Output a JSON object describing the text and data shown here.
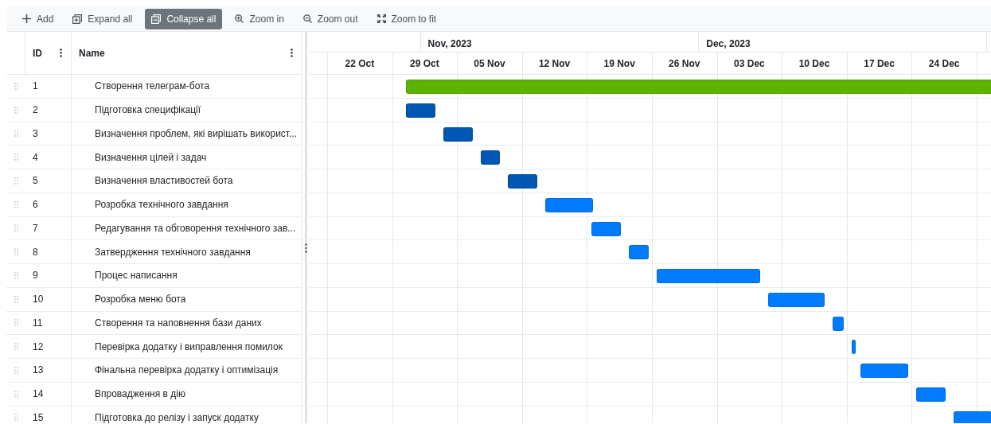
{
  "toolbar": [
    {
      "label": "Add",
      "kind": "add",
      "selected": false
    },
    {
      "label": "Expand all",
      "kind": "expand",
      "selected": false
    },
    {
      "label": "Collapse all",
      "kind": "collapse",
      "selected": true
    },
    {
      "label": "Zoom in",
      "kind": "zoomin",
      "selected": false
    },
    {
      "label": "Zoom out",
      "kind": "zoomout",
      "selected": false
    },
    {
      "label": "Zoom to fit",
      "kind": "fit",
      "selected": false
    }
  ],
  "grid": {
    "columns": [
      "ID",
      "Name"
    ]
  },
  "timeline": {
    "months": [
      "Nov, 2023",
      "Dec, 2023"
    ],
    "weeks": [
      "22 Oct",
      "29 Oct",
      "05 Nov",
      "12 Nov",
      "19 Nov",
      "26 Nov",
      "03 Dec",
      "10 Dec",
      "17 Dec",
      "24 Dec"
    ]
  },
  "tasks": [
    {
      "id": "1",
      "name": "Створення телеграм-бота",
      "color": "#5cb300"
    },
    {
      "id": "2",
      "name": "Підготовка специфікації",
      "color": "#0056b3"
    },
    {
      "id": "3",
      "name": "Визначення проблем, які вирішать використ...",
      "color": "#0056b3"
    },
    {
      "id": "4",
      "name": "Визначення цілей і задач",
      "color": "#0056b3"
    },
    {
      "id": "5",
      "name": "Визначення властивостей бота",
      "color": "#0056b3"
    },
    {
      "id": "6",
      "name": "Розробка технічного завдання",
      "color": "#007bff"
    },
    {
      "id": "7",
      "name": "Редагування та обговорення технічного зав...",
      "color": "#007bff"
    },
    {
      "id": "8",
      "name": "Затвердження технічного завдання",
      "color": "#007bff"
    },
    {
      "id": "9",
      "name": "Процес написання",
      "color": "#007bff"
    },
    {
      "id": "10",
      "name": "Розробка меню бота",
      "color": "#007bff"
    },
    {
      "id": "11",
      "name": "Створення та наповнення бази даних",
      "color": "#007bff"
    },
    {
      "id": "12",
      "name": "Перевірка додатку і виправлення помилок",
      "color": "#007bff"
    },
    {
      "id": "13",
      "name": "Фінальна перевірка додатку і оптимізація",
      "color": "#007bff"
    },
    {
      "id": "14",
      "name": "Впровадження в дію",
      "color": "#007bff"
    },
    {
      "id": "15",
      "name": "Підготовка до релізу і запуск додатку",
      "color": "#007bff"
    }
  ]
}
